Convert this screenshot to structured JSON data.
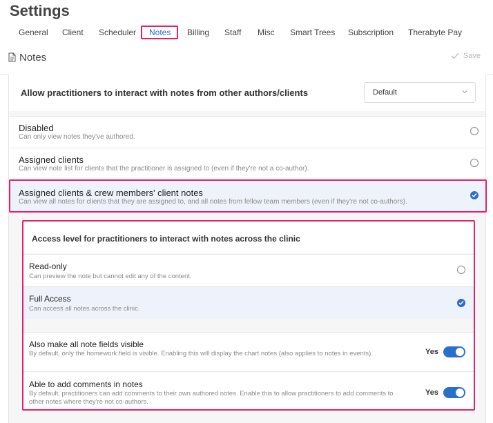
{
  "page": {
    "title": "Settings"
  },
  "tabs": [
    "General",
    "Client",
    "Scheduler",
    "Notes",
    "Billing",
    "Staff",
    "Misc",
    "Smart Trees",
    "Subscription",
    "Therabyte Pay"
  ],
  "active_tab": "Notes",
  "section": {
    "title": "Notes",
    "save_label": "Save",
    "icon": "document-icon"
  },
  "interaction": {
    "heading": "Allow practitioners to interact with notes from other authors/clients",
    "dropdown_value": "Default",
    "options": [
      {
        "title": "Disabled",
        "desc": "Can only view notes they've authored.",
        "selected": false
      },
      {
        "title": "Assigned clients",
        "desc": "Can view note list for clients that the practitioner is assigned to (even if they're not a co-author).",
        "selected": false
      },
      {
        "title": "Assigned clients & crew members' client notes",
        "desc": "Can view all notes for clients that they are assigned to, and all notes from fellow team members (even if they're not co-authors).",
        "selected": true
      }
    ]
  },
  "access": {
    "heading": "Access level for practitioners to interact with notes across the clinic",
    "options": [
      {
        "title": "Read-only",
        "desc": "Can preview the note but cannot edit any of the content.",
        "selected": false
      },
      {
        "title": "Full Access",
        "desc": "Can access all notes across the clinic.",
        "selected": true
      }
    ],
    "toggles": [
      {
        "title": "Also make all note fields visible",
        "desc": "By default, only the homework field is visible. Enabling this will display the chart notes (also applies to notes in events).",
        "value_label": "Yes",
        "on": true
      },
      {
        "title": "Able to add comments in notes",
        "desc": "By default, practitioners can add comments to their own authored notes. Enable this to allow practitioners to add comments to other notes where they're not co-authors.",
        "value_label": "Yes",
        "on": true
      }
    ]
  },
  "colors": {
    "accent": "#2a6fc9",
    "highlight": "#e0226e"
  }
}
